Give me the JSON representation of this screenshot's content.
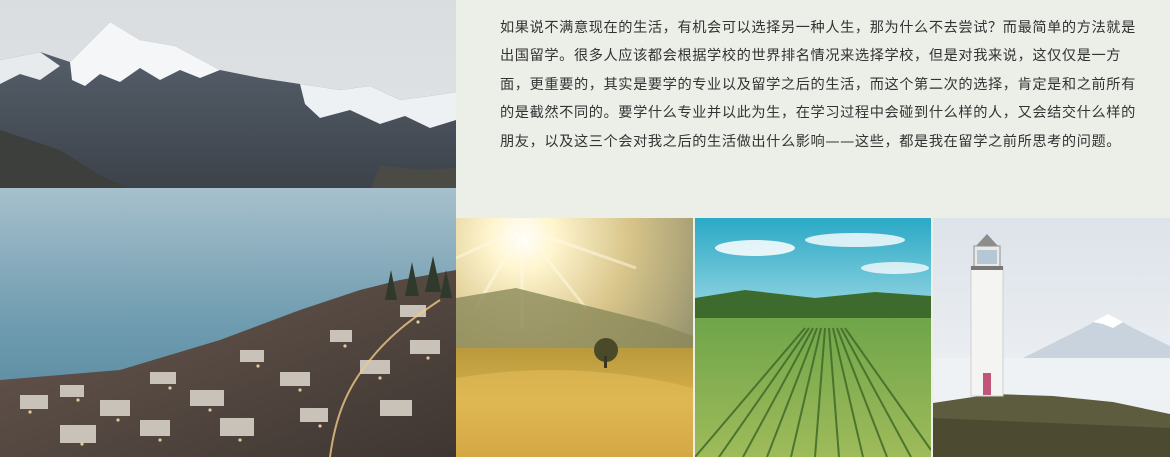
{
  "intro": {
    "paragraph": "如果说不满意现在的生活，有机会可以选择另一种人生，那为什么不去尝试？而最简单的方法就是出国留学。很多人应该都会根据学校的世界排名情况来选择学校，但是对我来说，这仅仅是一方面，更重要的，其实是要学的专业以及留学之后的生活，而这个第二次的选择，肯定是和之前所有的是截然不同的。要学什么专业并以此为生，在学习过程中会碰到什么样的人，又会结交什么样的朋友，以及这三个会对我之后的生活做出什么影响——这些，都是我在留学之前所思考的问题。"
  },
  "photos": {
    "main": "lake-mountain-town-photo",
    "sun_field": "golden-field-sunrays-photo",
    "vineyard": "green-vineyard-photo",
    "lighthouse": "white-lighthouse-photo"
  },
  "colors": {
    "background": "#eceee8",
    "text": "#333333"
  }
}
